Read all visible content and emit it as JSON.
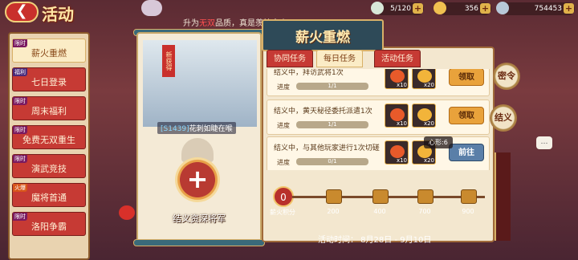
{
  "header": {
    "back_icon": "back-arrow-icon",
    "title": "活动",
    "announcement_prefix": "升为",
    "announcement_red": "无双",
    "announcement_suffix": "品质，真是羡煞旁人"
  },
  "resources": [
    {
      "icon": "jade-icon",
      "value": "5/120"
    },
    {
      "icon": "gold-icon",
      "value": "356"
    },
    {
      "icon": "silver-icon",
      "value": "754453"
    }
  ],
  "sidebar": {
    "items": [
      {
        "badge": "限时",
        "label": "薪火重燃",
        "active": true
      },
      {
        "badge": "福利",
        "label": "七日登录"
      },
      {
        "badge": "限时",
        "label": "周末福利"
      },
      {
        "badge": "限时",
        "label": "免费无双重生"
      },
      {
        "badge": "限时",
        "label": "演武竞技"
      },
      {
        "badge": "火爆",
        "label": "魔将首通"
      },
      {
        "badge": "限时",
        "label": "洛阳争霸"
      }
    ]
  },
  "hero_card": {
    "tag": "新获得",
    "id": "[S1439]",
    "name": "花刺如睫在喉",
    "slot_label": "结义资深将军"
  },
  "panel": {
    "title": "薪火重燃",
    "tabs": [
      "协同任务",
      "每日任务",
      "活动任务"
    ],
    "active_tab": 1,
    "tasks": [
      {
        "desc": "结义中，拜访武将1次",
        "progress_label": "进度",
        "progress": "1/1",
        "rewards": [
          "x10",
          "x20"
        ],
        "button": "领取"
      },
      {
        "desc": "结义中，黄天秘径委托派遣1次",
        "progress_label": "进度",
        "progress": "1/1",
        "rewards": [
          "x10",
          "x20"
        ],
        "button": "领取"
      },
      {
        "desc": "结义中，与其他玩家进行1次切磋",
        "progress_label": "进度",
        "progress": "0/1",
        "rewards": [
          "x10",
          "x20"
        ],
        "button": "前往"
      }
    ]
  },
  "points": {
    "current": "0",
    "label": "薪火积分",
    "milestones": [
      "200",
      "400",
      "700",
      "900"
    ]
  },
  "activity_time": "活动时间： 8月28日 - 9月10日",
  "side_buttons": [
    "密令",
    "结义"
  ],
  "tooltip": "心形:6"
}
